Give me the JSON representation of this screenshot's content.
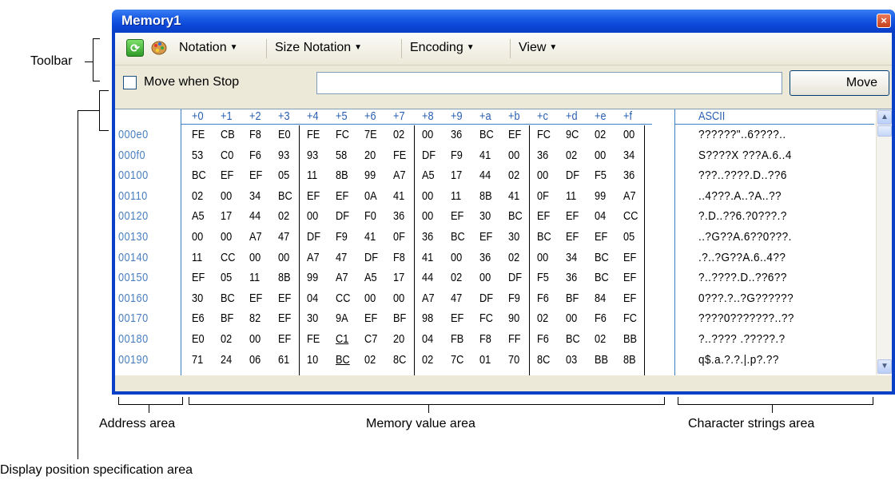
{
  "window": {
    "title": "Memory1",
    "close_glyph": "×"
  },
  "toolbar": {
    "icons": [
      "refresh-icon",
      "palette-icon"
    ],
    "menus": [
      {
        "label": "Notation",
        "accesskey": "N"
      },
      {
        "label": "Size Notation",
        "accesskey": "z"
      },
      {
        "label": "Encoding",
        "accesskey": "c"
      },
      {
        "label": "View",
        "accesskey": "i"
      }
    ]
  },
  "position_bar": {
    "checkbox_label": "Move when Stop",
    "checked": false,
    "input_value": "",
    "button_label": "Move"
  },
  "grid": {
    "column_headers": [
      "+0",
      "+1",
      "+2",
      "+3",
      "+4",
      "+5",
      "+6",
      "+7",
      "+8",
      "+9",
      "+a",
      "+b",
      "+c",
      "+d",
      "+e",
      "+f"
    ],
    "ascii_header": "ASCII",
    "rows": [
      {
        "addr": "000e0",
        "bytes": [
          "FE",
          "CB",
          "F8",
          "E0",
          "FE",
          "FC",
          "7E",
          "02",
          "00",
          "36",
          "BC",
          "EF",
          "FC",
          "9C",
          "02",
          "00"
        ],
        "ascii": "??????\"..6????.."
      },
      {
        "addr": "000f0",
        "bytes": [
          "53",
          "C0",
          "F6",
          "93",
          "93",
          "58",
          "20",
          "FE",
          "DF",
          "F9",
          "41",
          "00",
          "36",
          "02",
          "00",
          "34"
        ],
        "ascii": "S????X ???A.6..4"
      },
      {
        "addr": "00100",
        "bytes": [
          "BC",
          "EF",
          "EF",
          "05",
          "11",
          "8B",
          "99",
          "A7",
          "A5",
          "17",
          "44",
          "02",
          "00",
          "DF",
          "F5",
          "36"
        ],
        "ascii": "???..????.D..??6"
      },
      {
        "addr": "00110",
        "bytes": [
          "02",
          "00",
          "34",
          "BC",
          "EF",
          "EF",
          "0A",
          "41",
          "00",
          "11",
          "8B",
          "41",
          "0F",
          "11",
          "99",
          "A7"
        ],
        "ascii": "..4???.A..?A..??"
      },
      {
        "addr": "00120",
        "bytes": [
          "A5",
          "17",
          "44",
          "02",
          "00",
          "DF",
          "F0",
          "36",
          "00",
          "EF",
          "30",
          "BC",
          "EF",
          "EF",
          "04",
          "CC"
        ],
        "ascii": "?.D..??6.?0???.?"
      },
      {
        "addr": "00130",
        "bytes": [
          "00",
          "00",
          "A7",
          "47",
          "DF",
          "F9",
          "41",
          "0F",
          "36",
          "BC",
          "EF",
          "30",
          "BC",
          "EF",
          "EF",
          "05"
        ],
        "ascii": "..?G??A.6??0???."
      },
      {
        "addr": "00140",
        "bytes": [
          "11",
          "CC",
          "00",
          "00",
          "A7",
          "47",
          "DF",
          "F8",
          "41",
          "00",
          "36",
          "02",
          "00",
          "34",
          "BC",
          "EF"
        ],
        "ascii": ".?..?G??A.6..4??"
      },
      {
        "addr": "00150",
        "bytes": [
          "EF",
          "05",
          "11",
          "8B",
          "99",
          "A7",
          "A5",
          "17",
          "44",
          "02",
          "00",
          "DF",
          "F5",
          "36",
          "BC",
          "EF"
        ],
        "ascii": "?..????.D..??6??"
      },
      {
        "addr": "00160",
        "bytes": [
          "30",
          "BC",
          "EF",
          "EF",
          "04",
          "CC",
          "00",
          "00",
          "A7",
          "47",
          "DF",
          "F9",
          "F6",
          "BF",
          "84",
          "EF"
        ],
        "ascii": "0???.?..?G??????"
      },
      {
        "addr": "00170",
        "bytes": [
          "E6",
          "BF",
          "82",
          "EF",
          "30",
          "9A",
          "EF",
          "BF",
          "98",
          "EF",
          "FC",
          "90",
          "02",
          "00",
          "F6",
          "FC"
        ],
        "ascii": "????0???????..??"
      },
      {
        "addr": "00180",
        "bytes": [
          "E0",
          "02",
          "00",
          "EF",
          "FE",
          "C1",
          "C7",
          "20",
          "04",
          "FB",
          "F8",
          "FF",
          "F6",
          "BC",
          "02",
          "BB"
        ],
        "ascii": "?..???? .?????.?"
      },
      {
        "addr": "00190",
        "bytes": [
          "71",
          "24",
          "06",
          "61",
          "10",
          "BC",
          "02",
          "8C",
          "02",
          "7C",
          "01",
          "70",
          "8C",
          "03",
          "BB",
          "8B"
        ],
        "ascii": "q$.a.?.?.|.p?.??"
      }
    ],
    "underlined": [
      "C1",
      "BC"
    ]
  },
  "annotations": {
    "toolbar": "Toolbar",
    "display_position": "Display position specification area",
    "address": "Address area",
    "memory_value": "Memory value area",
    "character_strings": "Character strings area"
  },
  "colors": {
    "title_blue": "#0a46d8",
    "address_blue": "#4a7fc0",
    "header_blue": "#2a5fb0",
    "face": "#ece9d8"
  }
}
